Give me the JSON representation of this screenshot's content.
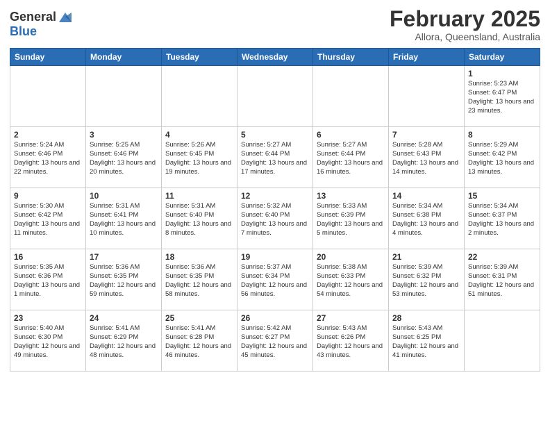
{
  "header": {
    "logo": {
      "line1": "General",
      "line2": "Blue"
    },
    "month": "February 2025",
    "location": "Allora, Queensland, Australia"
  },
  "days_of_week": [
    "Sunday",
    "Monday",
    "Tuesday",
    "Wednesday",
    "Thursday",
    "Friday",
    "Saturday"
  ],
  "weeks": [
    [
      {
        "day": "",
        "info": ""
      },
      {
        "day": "",
        "info": ""
      },
      {
        "day": "",
        "info": ""
      },
      {
        "day": "",
        "info": ""
      },
      {
        "day": "",
        "info": ""
      },
      {
        "day": "",
        "info": ""
      },
      {
        "day": "1",
        "info": "Sunrise: 5:23 AM\nSunset: 6:47 PM\nDaylight: 13 hours and 23 minutes."
      }
    ],
    [
      {
        "day": "2",
        "info": "Sunrise: 5:24 AM\nSunset: 6:46 PM\nDaylight: 13 hours and 22 minutes."
      },
      {
        "day": "3",
        "info": "Sunrise: 5:25 AM\nSunset: 6:46 PM\nDaylight: 13 hours and 20 minutes."
      },
      {
        "day": "4",
        "info": "Sunrise: 5:26 AM\nSunset: 6:45 PM\nDaylight: 13 hours and 19 minutes."
      },
      {
        "day": "5",
        "info": "Sunrise: 5:27 AM\nSunset: 6:44 PM\nDaylight: 13 hours and 17 minutes."
      },
      {
        "day": "6",
        "info": "Sunrise: 5:27 AM\nSunset: 6:44 PM\nDaylight: 13 hours and 16 minutes."
      },
      {
        "day": "7",
        "info": "Sunrise: 5:28 AM\nSunset: 6:43 PM\nDaylight: 13 hours and 14 minutes."
      },
      {
        "day": "8",
        "info": "Sunrise: 5:29 AM\nSunset: 6:42 PM\nDaylight: 13 hours and 13 minutes."
      }
    ],
    [
      {
        "day": "9",
        "info": "Sunrise: 5:30 AM\nSunset: 6:42 PM\nDaylight: 13 hours and 11 minutes."
      },
      {
        "day": "10",
        "info": "Sunrise: 5:31 AM\nSunset: 6:41 PM\nDaylight: 13 hours and 10 minutes."
      },
      {
        "day": "11",
        "info": "Sunrise: 5:31 AM\nSunset: 6:40 PM\nDaylight: 13 hours and 8 minutes."
      },
      {
        "day": "12",
        "info": "Sunrise: 5:32 AM\nSunset: 6:40 PM\nDaylight: 13 hours and 7 minutes."
      },
      {
        "day": "13",
        "info": "Sunrise: 5:33 AM\nSunset: 6:39 PM\nDaylight: 13 hours and 5 minutes."
      },
      {
        "day": "14",
        "info": "Sunrise: 5:34 AM\nSunset: 6:38 PM\nDaylight: 13 hours and 4 minutes."
      },
      {
        "day": "15",
        "info": "Sunrise: 5:34 AM\nSunset: 6:37 PM\nDaylight: 13 hours and 2 minutes."
      }
    ],
    [
      {
        "day": "16",
        "info": "Sunrise: 5:35 AM\nSunset: 6:36 PM\nDaylight: 13 hours and 1 minute."
      },
      {
        "day": "17",
        "info": "Sunrise: 5:36 AM\nSunset: 6:35 PM\nDaylight: 12 hours and 59 minutes."
      },
      {
        "day": "18",
        "info": "Sunrise: 5:36 AM\nSunset: 6:35 PM\nDaylight: 12 hours and 58 minutes."
      },
      {
        "day": "19",
        "info": "Sunrise: 5:37 AM\nSunset: 6:34 PM\nDaylight: 12 hours and 56 minutes."
      },
      {
        "day": "20",
        "info": "Sunrise: 5:38 AM\nSunset: 6:33 PM\nDaylight: 12 hours and 54 minutes."
      },
      {
        "day": "21",
        "info": "Sunrise: 5:39 AM\nSunset: 6:32 PM\nDaylight: 12 hours and 53 minutes."
      },
      {
        "day": "22",
        "info": "Sunrise: 5:39 AM\nSunset: 6:31 PM\nDaylight: 12 hours and 51 minutes."
      }
    ],
    [
      {
        "day": "23",
        "info": "Sunrise: 5:40 AM\nSunset: 6:30 PM\nDaylight: 12 hours and 49 minutes."
      },
      {
        "day": "24",
        "info": "Sunrise: 5:41 AM\nSunset: 6:29 PM\nDaylight: 12 hours and 48 minutes."
      },
      {
        "day": "25",
        "info": "Sunrise: 5:41 AM\nSunset: 6:28 PM\nDaylight: 12 hours and 46 minutes."
      },
      {
        "day": "26",
        "info": "Sunrise: 5:42 AM\nSunset: 6:27 PM\nDaylight: 12 hours and 45 minutes."
      },
      {
        "day": "27",
        "info": "Sunrise: 5:43 AM\nSunset: 6:26 PM\nDaylight: 12 hours and 43 minutes."
      },
      {
        "day": "28",
        "info": "Sunrise: 5:43 AM\nSunset: 6:25 PM\nDaylight: 12 hours and 41 minutes."
      },
      {
        "day": "",
        "info": ""
      }
    ]
  ]
}
